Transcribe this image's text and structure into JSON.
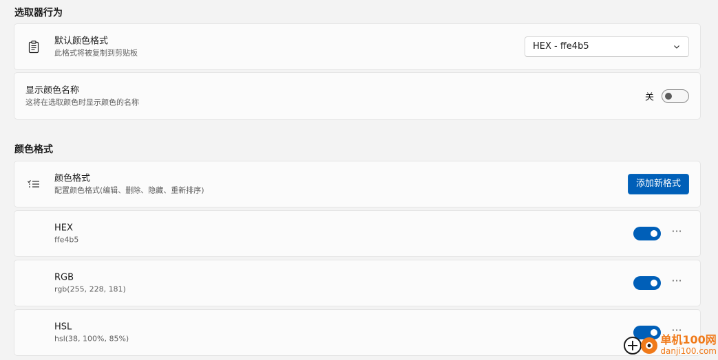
{
  "picker_behavior": {
    "section_title": "选取器行为",
    "default_format": {
      "title": "默认颜色格式",
      "subtitle": "此格式将被复制到剪贴板",
      "icon": "clipboard-icon",
      "selected_value": "HEX - ffe4b5"
    },
    "show_color_name": {
      "title": "显示颜色名称",
      "subtitle": "这将在选取颜色时显示颜色的名称",
      "state_label": "关",
      "enabled": false
    }
  },
  "color_formats": {
    "section_title": "颜色格式",
    "header": {
      "title": "颜色格式",
      "subtitle": "配置颜色格式(编辑、删除、隐藏、重新排序)",
      "icon": "checklist-icon",
      "add_button_label": "添加新格式"
    },
    "items": [
      {
        "name": "HEX",
        "value": "ffe4b5",
        "enabled": true
      },
      {
        "name": "RGB",
        "value": "rgb(255, 228, 181)",
        "enabled": true
      },
      {
        "name": "HSL",
        "value": "hsl(38, 100%, 85%)",
        "enabled": true
      }
    ],
    "more_glyph": "···"
  },
  "watermark": {
    "brand": "单机100网",
    "url": "danji100.com"
  },
  "colors": {
    "accent": "#005fb8",
    "background": "#f3f3f3",
    "card": "#fbfbfb",
    "watermark": "#f07a1a"
  }
}
